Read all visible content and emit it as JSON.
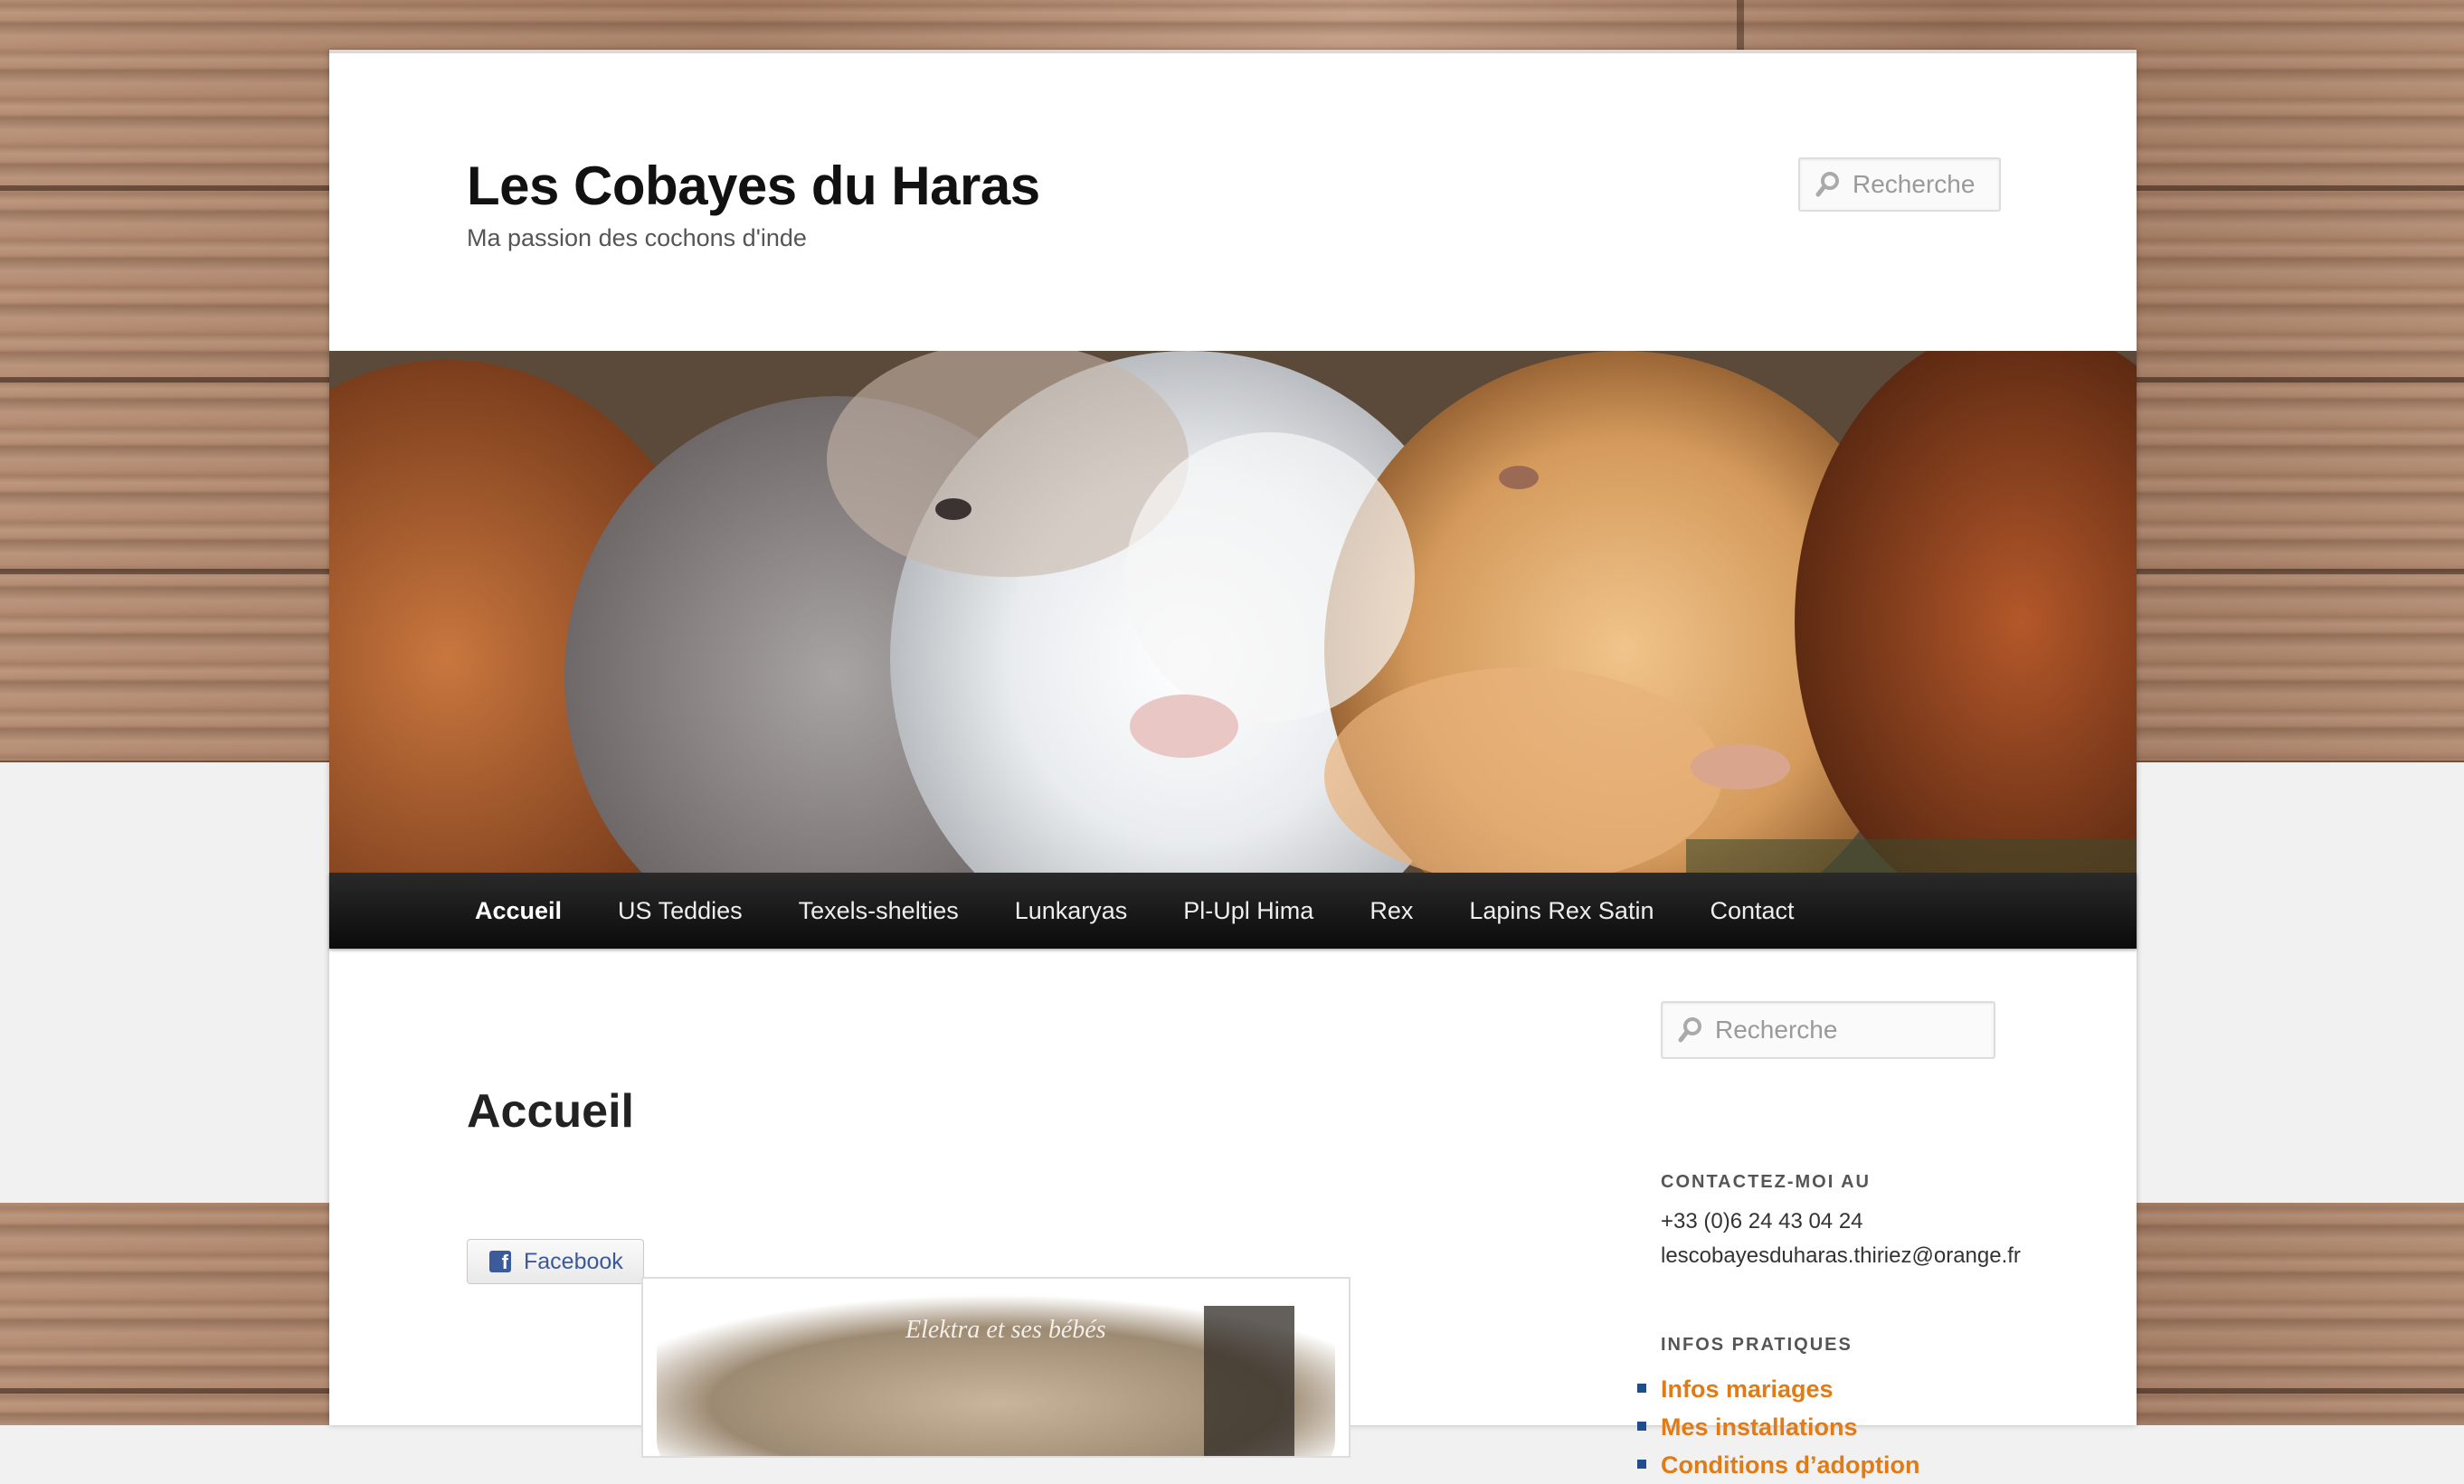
{
  "site": {
    "title": "Les Cobayes du Haras",
    "description": "Ma passion des cochons d'inde"
  },
  "search": {
    "placeholder": "Recherche"
  },
  "nav": {
    "items": [
      "Accueil",
      "US Teddies",
      "Texels-shelties",
      "Lunkaryas",
      "Pl-Upl Hima",
      "Rex",
      "Lapins Rex Satin",
      "Contact"
    ],
    "current": "Accueil"
  },
  "page": {
    "title": "Accueil",
    "facebook_label": "Facebook",
    "photo_caption": "Elektra et ses bébés"
  },
  "sidebar": {
    "search_placeholder": "Recherche",
    "contact_title": "CONTACTEZ-MOI AU",
    "phone": "+33 (0)6 24 43 04 24",
    "email": "lescobayesduharas.thiriez@orange.fr",
    "infos_title": "INFOS PRATIQUES",
    "links": [
      "Infos mariages",
      "Mes installations",
      "Conditions d’adoption"
    ]
  },
  "colors": {
    "link": "#e07b16",
    "bullet": "#1f4e8c",
    "nav_bg": "#1a1a1a",
    "facebook": "#3b5998"
  },
  "icons": {
    "search": "search-icon",
    "facebook": "facebook-icon"
  }
}
